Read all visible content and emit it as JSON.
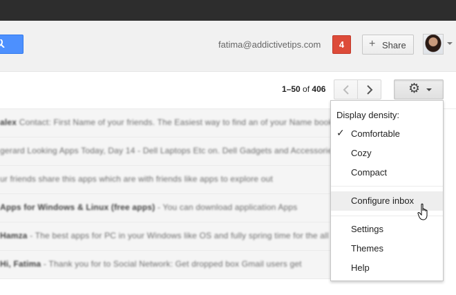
{
  "header": {
    "user_email": "fatima@addictivetips.com",
    "notification_count": "4",
    "share_label": "Share",
    "share_icon": "plus-icon"
  },
  "toolbar": {
    "range": "1–50",
    "of_label": "of",
    "total": "406",
    "prev_icon": "chevron-left-icon",
    "next_icon": "chevron-right-icon",
    "settings_icon": "gear-icon"
  },
  "emails": [
    {
      "sender": "alex",
      "snippet": "Contact: First Name of your friends. The Easiest way to find an of your Name book"
    },
    {
      "sender": "",
      "snippet": "gerard Looking Apps Today, Day 14 - Dell Laptops Etc on. Dell Gadgets and Accessories"
    },
    {
      "sender": "",
      "snippet": "ur friends share this apps which are with friends like apps to explore out"
    },
    {
      "sender": "Apps for Windows & Linux (free apps)",
      "snippet": "- You can download application Apps"
    },
    {
      "sender": "Hamza",
      "snippet": "- The best apps for PC in your Windows like OS and fully spring time for the all"
    },
    {
      "sender": "Hi, Fatima",
      "snippet": "- Thank you for to Social Network: Get dropped box Gmail users get"
    }
  ],
  "settings_menu": {
    "heading": "Display density:",
    "density_options": [
      "Comfortable",
      "Cozy",
      "Compact"
    ],
    "selected_density": "Comfortable",
    "configure_inbox": "Configure inbox",
    "settings": "Settings",
    "themes": "Themes",
    "help": "Help"
  },
  "colors": {
    "accent_blue": "#4d90fe",
    "notification_red": "#dd4b39",
    "top_bar": "#2d2d2d"
  }
}
